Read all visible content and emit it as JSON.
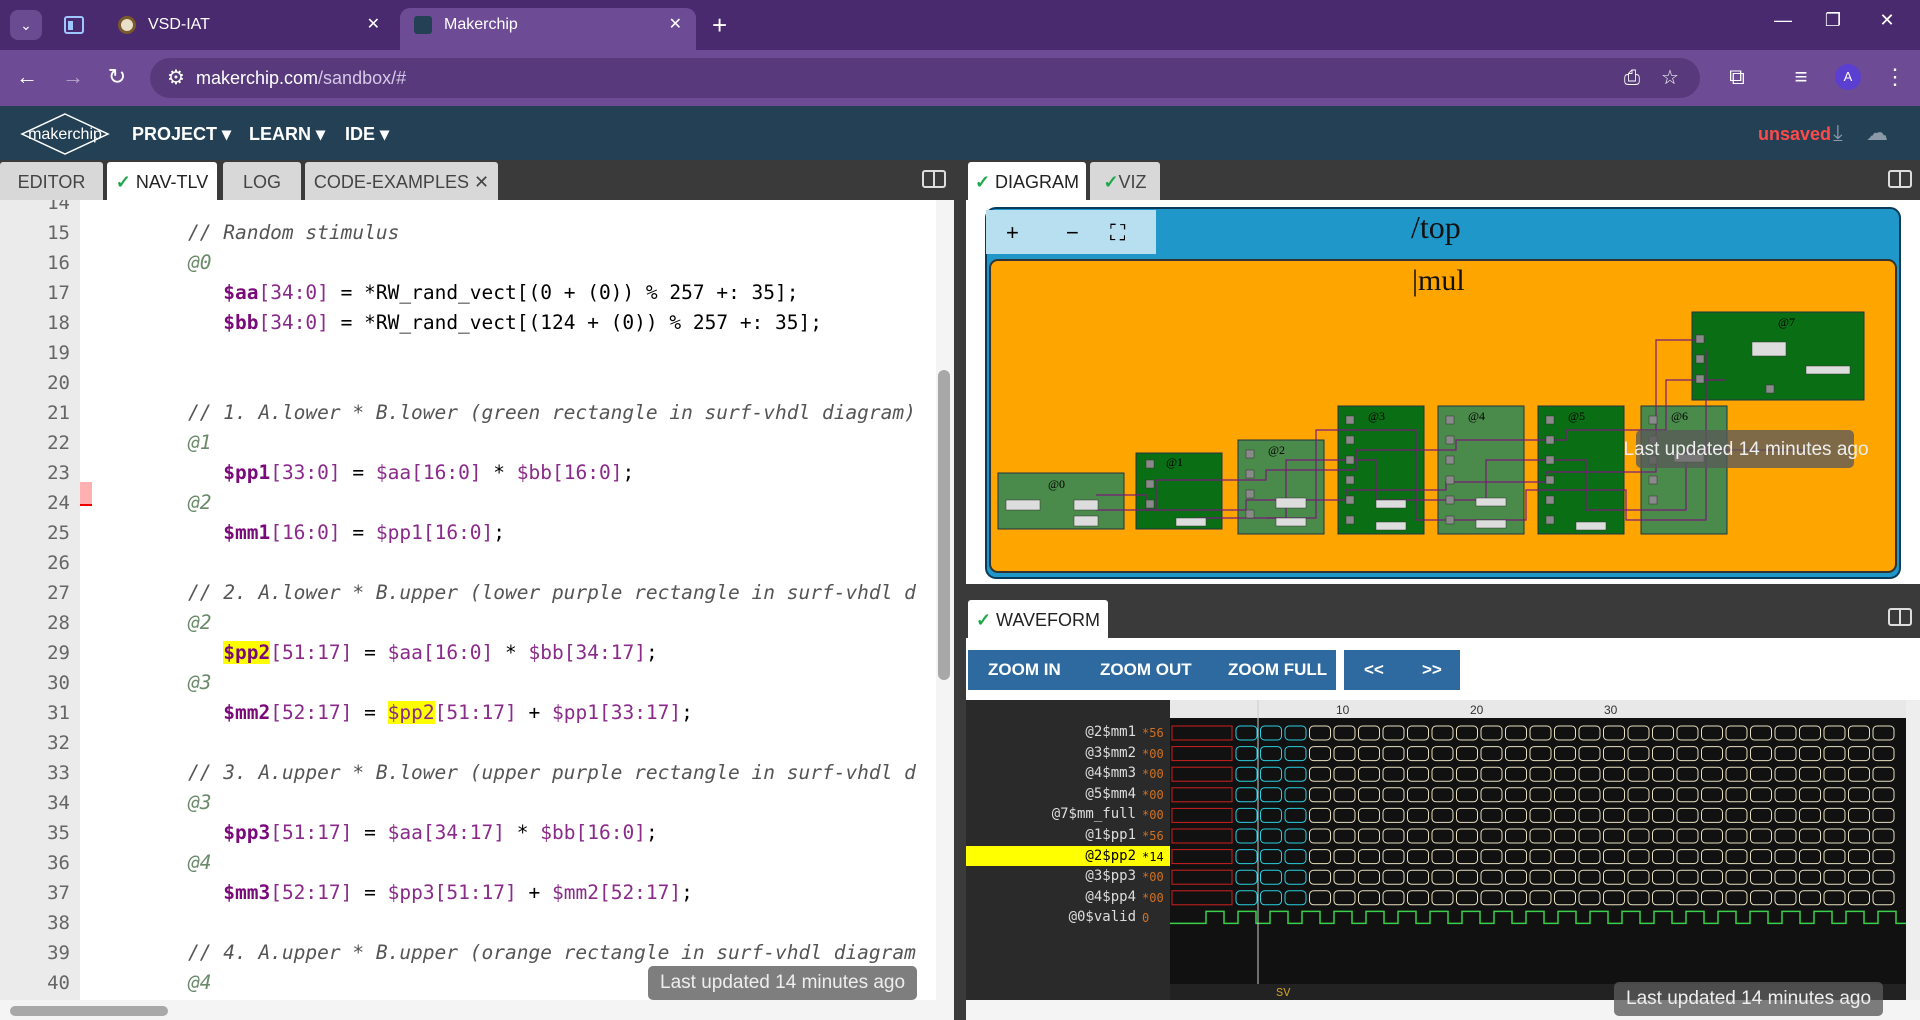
{
  "browser": {
    "tabs": [
      {
        "title": "VSD-IAT"
      },
      {
        "title": "Makerchip"
      }
    ],
    "url_host": "makerchip.com",
    "url_path": "/sandbox/#",
    "avatar_letter": "A"
  },
  "app": {
    "logo_text": "makerchip",
    "menus": [
      "PROJECT ▾",
      "LEARN ▾",
      "IDE ▾"
    ],
    "status": "unsaved"
  },
  "left_tabs": [
    "EDITOR",
    "NAV-TLV",
    "LOG",
    "CODE-EXAMPLES"
  ],
  "editor": {
    "lines": [
      {
        "n": "14",
        "parts": []
      },
      {
        "n": "15",
        "parts": [
          [
            "cm",
            "// Random stimulus"
          ]
        ]
      },
      {
        "n": "16",
        "parts": [
          [
            "stg",
            "@0"
          ]
        ]
      },
      {
        "n": "17",
        "parts": [
          [
            "ind",
            "   "
          ],
          [
            "sig",
            "$aa"
          ],
          [
            "sig2",
            "[34:0]"
          ],
          [
            "ws",
            " = *RW_rand_vect[(0 + (0)) % 257 +: 35];"
          ]
        ]
      },
      {
        "n": "18",
        "parts": [
          [
            "ind",
            "   "
          ],
          [
            "sig",
            "$bb"
          ],
          [
            "sig2",
            "[34:0]"
          ],
          [
            "ws",
            " = *RW_rand_vect[(124 + (0)) % 257 +: 35];"
          ]
        ]
      },
      {
        "n": "19",
        "parts": []
      },
      {
        "n": "20",
        "parts": []
      },
      {
        "n": "21",
        "parts": [
          [
            "cm",
            "// 1. A.lower * B.lower (green rectangle in surf-vhdl diagram)"
          ]
        ]
      },
      {
        "n": "22",
        "parts": [
          [
            "stg",
            "@1"
          ]
        ]
      },
      {
        "n": "23",
        "parts": [
          [
            "ind",
            "   "
          ],
          [
            "sig",
            "$pp1"
          ],
          [
            "sig2",
            "[33:0]"
          ],
          [
            "ws",
            " = "
          ],
          [
            "sig2",
            "$aa[16:0]"
          ],
          [
            "ws",
            " * "
          ],
          [
            "sig2",
            "$bb[16:0]"
          ],
          [
            "ws",
            ";"
          ]
        ]
      },
      {
        "n": "24",
        "parts": [
          [
            "stg",
            "@2"
          ]
        ]
      },
      {
        "n": "25",
        "parts": [
          [
            "ind",
            "   "
          ],
          [
            "sig",
            "$mm1"
          ],
          [
            "sig2",
            "[16:0]"
          ],
          [
            "ws",
            " = "
          ],
          [
            "sig2",
            "$pp1[16:0]"
          ],
          [
            "ws",
            ";"
          ]
        ]
      },
      {
        "n": "26",
        "parts": []
      },
      {
        "n": "27",
        "parts": [
          [
            "cm",
            "// 2. A.lower * B.upper (lower purple rectangle in surf-vhdl d"
          ]
        ]
      },
      {
        "n": "28",
        "parts": [
          [
            "stg",
            "@2"
          ]
        ]
      },
      {
        "n": "29",
        "parts": [
          [
            "ind",
            "   "
          ],
          [
            "sighl",
            "$pp2"
          ],
          [
            "sig2",
            "[51:17]"
          ],
          [
            "ws",
            " = "
          ],
          [
            "sig2",
            "$aa[16:0]"
          ],
          [
            "ws",
            " * "
          ],
          [
            "sig2",
            "$bb[34:17]"
          ],
          [
            "ws",
            ";"
          ]
        ]
      },
      {
        "n": "30",
        "parts": [
          [
            "stg",
            "@3"
          ]
        ]
      },
      {
        "n": "31",
        "parts": [
          [
            "ind",
            "   "
          ],
          [
            "sig",
            "$mm2"
          ],
          [
            "sig2",
            "[52:17]"
          ],
          [
            "ws",
            " = "
          ],
          [
            "sig2hl",
            "$pp2"
          ],
          [
            "sig2",
            "[51:17]"
          ],
          [
            "ws",
            " + "
          ],
          [
            "sig2",
            "$pp1[33:17]"
          ],
          [
            "ws",
            ";"
          ]
        ]
      },
      {
        "n": "32",
        "parts": []
      },
      {
        "n": "33",
        "parts": [
          [
            "cm",
            "// 3. A.upper * B.lower (upper purple rectangle in surf-vhdl d"
          ]
        ]
      },
      {
        "n": "34",
        "parts": [
          [
            "stg",
            "@3"
          ]
        ]
      },
      {
        "n": "35",
        "parts": [
          [
            "ind",
            "   "
          ],
          [
            "sig",
            "$pp3"
          ],
          [
            "sig2",
            "[51:17]"
          ],
          [
            "ws",
            " = "
          ],
          [
            "sig2",
            "$aa[34:17]"
          ],
          [
            "ws",
            " * "
          ],
          [
            "sig2",
            "$bb[16:0]"
          ],
          [
            "ws",
            ";"
          ]
        ]
      },
      {
        "n": "36",
        "parts": [
          [
            "stg",
            "@4"
          ]
        ]
      },
      {
        "n": "37",
        "parts": [
          [
            "ind",
            "   "
          ],
          [
            "sig",
            "$mm3"
          ],
          [
            "sig2",
            "[52:17]"
          ],
          [
            "ws",
            " = "
          ],
          [
            "sig2",
            "$pp3[51:17]"
          ],
          [
            "ws",
            " + "
          ],
          [
            "sig2",
            "$mm2[52:17]"
          ],
          [
            "ws",
            ";"
          ]
        ]
      },
      {
        "n": "38",
        "parts": []
      },
      {
        "n": "39",
        "parts": [
          [
            "cm",
            "// 4. A.upper * B.upper (orange rectangle in surf-vhdl diagram"
          ]
        ]
      },
      {
        "n": "40",
        "parts": [
          [
            "stg",
            "@4"
          ]
        ]
      }
    ],
    "last_updated": "Last updated 14 minutes ago"
  },
  "right_tabs": [
    "DIAGRAM",
    "VIZ"
  ],
  "diagram": {
    "top_label": "/top",
    "mul_label": "|mul",
    "zoom_in": "+",
    "zoom_out": "−",
    "fit": "⛶",
    "stages": [
      "@0",
      "@1",
      "@2",
      "@3",
      "@4",
      "@5",
      "@6",
      "@7"
    ],
    "last_updated": "Last updated 14 minutes ago"
  },
  "waveform": {
    "tab": "WAVEFORM",
    "buttons": [
      "ZOOM IN",
      "ZOOM OUT",
      "ZOOM FULL",
      "<<",
      ">>"
    ],
    "ruler": [
      "10",
      "20",
      "30"
    ],
    "signals": [
      {
        "name": "@2$mm1",
        "val": "*56"
      },
      {
        "name": "@3$mm2",
        "val": "*00"
      },
      {
        "name": "@4$mm3",
        "val": "*00"
      },
      {
        "name": "@5$mm4",
        "val": "*00"
      },
      {
        "name": "@7$mm_full",
        "val": "*00"
      },
      {
        "name": "@1$pp1",
        "val": "*56"
      },
      {
        "name": "@2$pp2",
        "val": "*14"
      },
      {
        "name": "@3$pp3",
        "val": "*00"
      },
      {
        "name": "@4$pp4",
        "val": "*00"
      },
      {
        "name": "@0$valid",
        "val": "0"
      }
    ],
    "footer_left": "+ SV",
    "footer_mid": "SV",
    "last_updated": "Last updated 14 minutes ago"
  },
  "colors": {
    "accent": "#6e4c95",
    "header": "#234055",
    "diagram_blue": "#1f97c8",
    "diagram_orange": "#ffa500",
    "stage_green": "#0a6e14"
  }
}
